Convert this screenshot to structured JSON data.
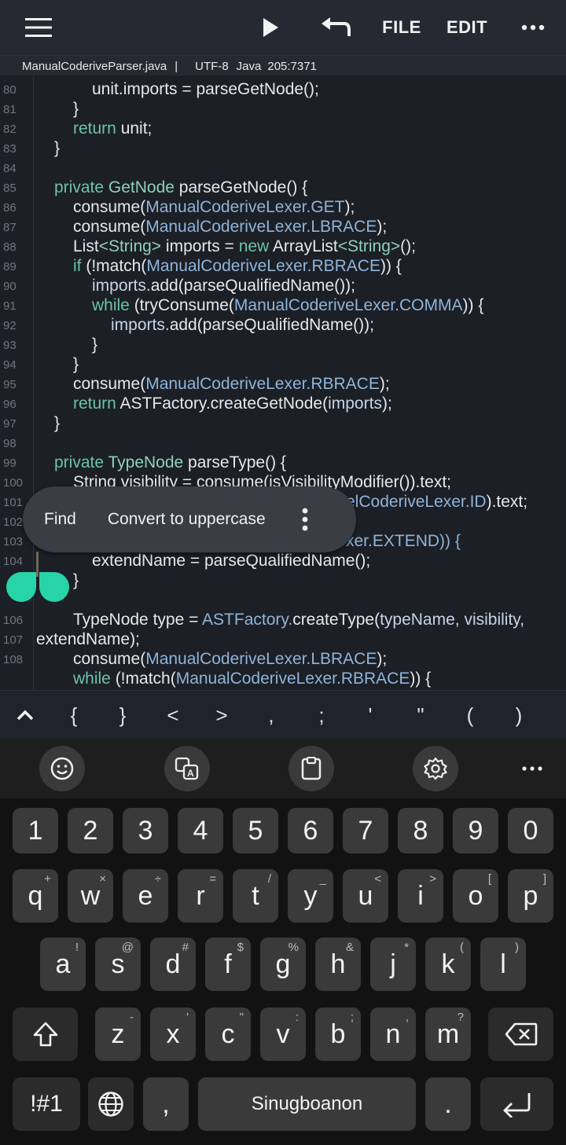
{
  "toolbar": {
    "menu_icon": "hamburger-menu-icon",
    "run_icon": "play-icon",
    "undo_icon": "undo-icon",
    "file_label": "FILE",
    "edit_label": "EDIT",
    "more_icon": "more-dots-icon"
  },
  "status": {
    "filename": "ManualCoderiveParser.java",
    "separator": "|",
    "encoding": "UTF-8",
    "language": "Java",
    "cursor": "205:7371"
  },
  "code": {
    "line_numbers": [
      "80",
      "81",
      "82",
      "83",
      "84",
      "85",
      "86",
      "87",
      "88",
      "89",
      "90",
      "91",
      "92",
      "93",
      "94",
      "95",
      "96",
      "97",
      "98",
      "99",
      "100",
      "101",
      "102",
      "103",
      "104",
      "",
      "106",
      "107",
      "108"
    ],
    "line80": "unit.imports = parseGetNode();",
    "line81": "}",
    "line82_kw": "return",
    "line82_rest": " unit;",
    "line83": "}",
    "line85_kw": "private",
    "line85_type": "GetNode",
    "line85_rest": " parseGetNode() {",
    "line86_a": "consume(",
    "line86_b": "ManualCoderiveLexer.GET",
    "line86_c": ");",
    "line87_a": "consume(",
    "line87_b": "ManualCoderiveLexer.LBRACE",
    "line87_c": ");",
    "line88_a": "List",
    "line88_b": "<String>",
    "line88_c": " imports = ",
    "line88_d": "new",
    "line88_e": " ArrayList",
    "line88_f": "<String>",
    "line88_g": "();",
    "line89_a": "if",
    "line89_b": " (!match(",
    "line89_c": "ManualCoderiveLexer.RBRACE",
    "line89_d": ")) {",
    "line90_a": "imports.",
    "line90_b": "add(parseQualifiedName());",
    "line91_a": "while",
    "line91_b": " (tryConsume(",
    "line91_c": "ManualCoderiveLexer.COMMA",
    "line91_d": ")) {",
    "line92_a": "imports.",
    "line92_b": "add(parseQualifiedName());",
    "line93": "}",
    "line94": "}",
    "line95_a": "consume(",
    "line95_b": "ManualCoderiveLexer.RBRACE",
    "line95_c": ");",
    "line96_a": "return",
    "line96_b": " ASTFactory.",
    "line96_c": "createGetNode(",
    "line96_d": "imports",
    "line96_e": ");",
    "line97": "}",
    "line99_kw": "private",
    "line99_type": " TypeNode",
    "line99_rest": " parseType() {",
    "line100": "String visibility = consume(isVisibilityModifier()).text;",
    "line101_tail_a": "elCoderiveLexer.ID",
    "line101_tail_b": ").text;",
    "line103_tail": "xer.EXTEND)) {",
    "line104": "extendName = parseQualifiedName();",
    "line105": "}",
    "line106_a": "TypeNode type = ",
    "line106_b": "ASTFactory.",
    "line106_c": "createType(",
    "line106_d": "typeName, visibility,",
    "line107": "extendName);",
    "line108_a": "consume(",
    "line108_b": "ManualCoderiveLexer.LBRACE",
    "line108_c": ");",
    "line109_a": "while",
    "line109_b": " (!match(",
    "line109_c": "ManualCoderiveLexer.RBRACE",
    "line109_d": ")) {"
  },
  "popup": {
    "find": "Find",
    "uppercase": "Convert to uppercase",
    "more_icon": "vertical-dots-icon"
  },
  "symbols": [
    "{",
    "}",
    "<",
    ">",
    ",",
    ";",
    "'",
    "\"",
    "(",
    ")"
  ],
  "keyboard": {
    "tools": [
      "emoji-icon",
      "translate-icon",
      "clipboard-icon",
      "settings-icon",
      "more-dots-icon"
    ],
    "row_numbers": [
      "1",
      "2",
      "3",
      "4",
      "5",
      "6",
      "7",
      "8",
      "9",
      "0"
    ],
    "row_q": [
      [
        "q",
        "+"
      ],
      [
        "w",
        "×"
      ],
      [
        "e",
        "÷"
      ],
      [
        "r",
        "="
      ],
      [
        "t",
        "/"
      ],
      [
        "y",
        "_"
      ],
      [
        "u",
        "<"
      ],
      [
        "i",
        ">"
      ],
      [
        "o",
        "["
      ],
      [
        "p",
        "]"
      ]
    ],
    "row_a": [
      [
        "a",
        "!"
      ],
      [
        "s",
        "@"
      ],
      [
        "d",
        "#"
      ],
      [
        "f",
        "$"
      ],
      [
        "g",
        "%"
      ],
      [
        "h",
        "&"
      ],
      [
        "j",
        "*"
      ],
      [
        "k",
        "("
      ],
      [
        "l",
        ")"
      ]
    ],
    "row_z": [
      [
        "z",
        "-"
      ],
      [
        "x",
        "'"
      ],
      [
        "c",
        "\""
      ],
      [
        "v",
        ":"
      ],
      [
        "b",
        ";"
      ],
      [
        "n",
        ","
      ],
      [
        "m",
        "?"
      ]
    ],
    "symbols_key": "!#1",
    "comma": ",",
    "space_label": "Sinugboanon",
    "period": ".",
    "shift_icon": "shift-icon",
    "backspace_icon": "backspace-icon",
    "globe_icon": "globe-icon",
    "enter_icon": "enter-icon"
  }
}
